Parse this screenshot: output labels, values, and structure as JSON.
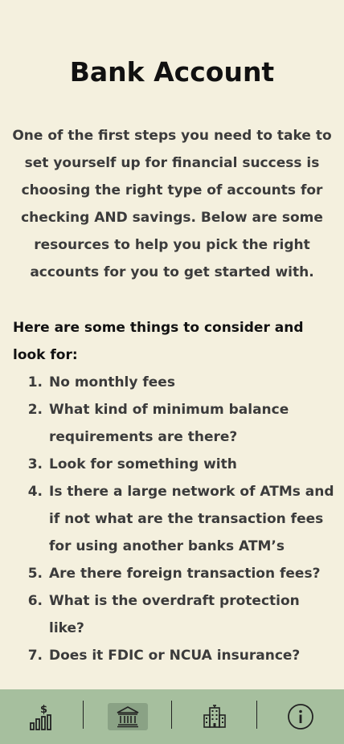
{
  "page": {
    "title": "Bank Account",
    "intro": "One of the first steps you need to take to set yourself up for financial success is choosing the right type of accounts for checking AND savings. Below are some resources to help you pick the right accounts for you to get started with.",
    "consider_heading": "Here are some things to consider and look for:",
    "consider_items": [
      {
        "num": "1.",
        "text": "No monthly fees"
      },
      {
        "num": "2.",
        "text": "What kind of minimum balance requirements are there?"
      },
      {
        "num": "3.",
        "text": "Look for something with"
      },
      {
        "num": "4.",
        "text": "Is there a large network of ATMs and if not what are the transaction fees for using another banks ATM’s"
      },
      {
        "num": "5.",
        "text": "Are there foreign transaction fees?"
      },
      {
        "num": "6.",
        "text": "What is the overdraft protection like?"
      },
      {
        "num": "7.",
        "text": "Does it FDIC or NCUA insurance?"
      }
    ]
  },
  "tabbar": {
    "tabs": [
      {
        "icon": "finance-chart-icon",
        "active": false
      },
      {
        "icon": "bank-icon",
        "active": true
      },
      {
        "icon": "buildings-icon",
        "active": false
      },
      {
        "icon": "info-icon",
        "active": false
      }
    ]
  },
  "colors": {
    "background": "#f4f0de",
    "tabbar": "#a6bf9e",
    "tab_active": "#8aa285",
    "text": "#3b3b3b",
    "heading": "#111111"
  }
}
